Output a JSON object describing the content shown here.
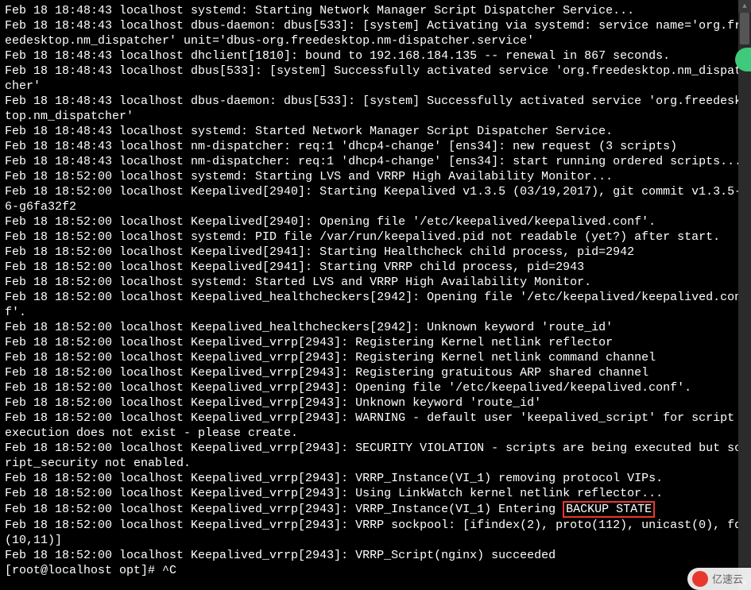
{
  "terminal": {
    "lines": [
      "Feb 18 18:48:43 localhost systemd: Starting Network Manager Script Dispatcher Service...",
      "Feb 18 18:48:43 localhost dbus-daemon: dbus[533]: [system] Activating via systemd: service name='org.freedesktop.nm_dispatcher' unit='dbus-org.freedesktop.nm-dispatcher.service'",
      "Feb 18 18:48:43 localhost dhclient[1810]: bound to 192.168.184.135 -- renewal in 867 seconds.",
      "Feb 18 18:48:43 localhost dbus[533]: [system] Successfully activated service 'org.freedesktop.nm_dispatcher'",
      "Feb 18 18:48:43 localhost dbus-daemon: dbus[533]: [system] Successfully activated service 'org.freedesktop.nm_dispatcher'",
      "Feb 18 18:48:43 localhost systemd: Started Network Manager Script Dispatcher Service.",
      "Feb 18 18:48:43 localhost nm-dispatcher: req:1 'dhcp4-change' [ens34]: new request (3 scripts)",
      "Feb 18 18:48:43 localhost nm-dispatcher: req:1 'dhcp4-change' [ens34]: start running ordered scripts...",
      "Feb 18 18:52:00 localhost systemd: Starting LVS and VRRP High Availability Monitor...",
      "Feb 18 18:52:00 localhost Keepalived[2940]: Starting Keepalived v1.3.5 (03/19,2017), git commit v1.3.5-6-g6fa32f2",
      "Feb 18 18:52:00 localhost Keepalived[2940]: Opening file '/etc/keepalived/keepalived.conf'.",
      "Feb 18 18:52:00 localhost systemd: PID file /var/run/keepalived.pid not readable (yet?) after start.",
      "Feb 18 18:52:00 localhost Keepalived[2941]: Starting Healthcheck child process, pid=2942",
      "Feb 18 18:52:00 localhost Keepalived[2941]: Starting VRRP child process, pid=2943",
      "Feb 18 18:52:00 localhost systemd: Started LVS and VRRP High Availability Monitor.",
      "Feb 18 18:52:00 localhost Keepalived_healthcheckers[2942]: Opening file '/etc/keepalived/keepalived.conf'.",
      "Feb 18 18:52:00 localhost Keepalived_healthcheckers[2942]: Unknown keyword 'route_id'",
      "Feb 18 18:52:00 localhost Keepalived_vrrp[2943]: Registering Kernel netlink reflector",
      "Feb 18 18:52:00 localhost Keepalived_vrrp[2943]: Registering Kernel netlink command channel",
      "Feb 18 18:52:00 localhost Keepalived_vrrp[2943]: Registering gratuitous ARP shared channel",
      "Feb 18 18:52:00 localhost Keepalived_vrrp[2943]: Opening file '/etc/keepalived/keepalived.conf'.",
      "Feb 18 18:52:00 localhost Keepalived_vrrp[2943]: Unknown keyword 'route_id'",
      "Feb 18 18:52:00 localhost Keepalived_vrrp[2943]: WARNING - default user 'keepalived_script' for script execution does not exist - please create.",
      "Feb 18 18:52:00 localhost Keepalived_vrrp[2943]: SECURITY VIOLATION - scripts are being executed but script_security not enabled.",
      "Feb 18 18:52:00 localhost Keepalived_vrrp[2943]: VRRP_Instance(VI_1) removing protocol VIPs.",
      "Feb 18 18:52:00 localhost Keepalived_vrrp[2943]: Using LinkWatch kernel netlink reflector..."
    ],
    "highlighted_line": {
      "prefix": "Feb 18 18:52:00 localhost Keepalived_vrrp[2943]: VRRP_Instance(VI_1) Entering ",
      "highlight": "BACKUP STATE"
    },
    "lines_after": [
      "Feb 18 18:52:00 localhost Keepalived_vrrp[2943]: VRRP sockpool: [ifindex(2), proto(112), unicast(0), fd(10,11)]",
      "Feb 18 18:52:00 localhost Keepalived_vrrp[2943]: VRRP_Script(nginx) succeeded"
    ],
    "prompt": "[root@localhost opt]# ",
    "prompt_input": "^C"
  },
  "watermark": {
    "text": "亿速云"
  }
}
